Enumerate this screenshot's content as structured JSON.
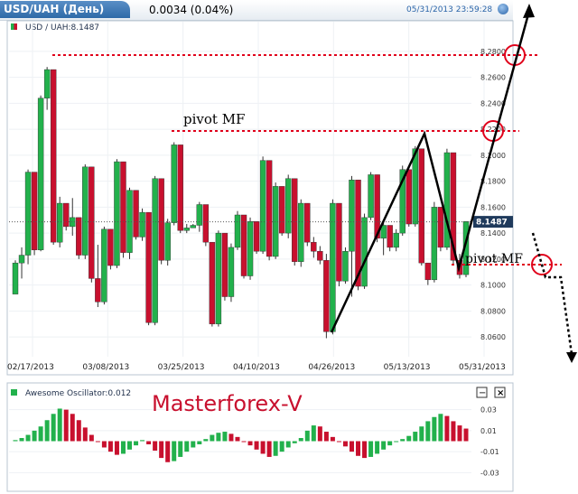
{
  "header": {
    "title": "USD/UAH (День)",
    "change": "0.0034 (0.04%)",
    "timestamp": "05/31/2013 23:59:28"
  },
  "main_panel": {
    "label": "USD / UAH:8.1487",
    "last_price": "8.1487"
  },
  "oscillator_panel": {
    "label": "Awesome Oscillator:0.012",
    "minimize": "−",
    "close": "×"
  },
  "watermark": "Masterforex-V",
  "annotations": {
    "pivot_upper": "pivot MF",
    "pivot_lower": "pivot MF"
  },
  "colors": {
    "up": "#22b14c",
    "down": "#c8102e",
    "pivot_line": "#e0001b",
    "watermark": "#c8102e",
    "header_blue": "#2e6aa8"
  },
  "chart_data": [
    {
      "type": "candlestick",
      "title": "USD / UAH:8.1487",
      "x_tick_labels": [
        "02/17/2013",
        "03/08/2013",
        "03/25/2013",
        "04/10/2013",
        "04/26/2013",
        "05/13/2013",
        "05/31/2013"
      ],
      "y_tick_labels": [
        "8.2800",
        "8.2600",
        "8.2400",
        "8.2200",
        "8.2000",
        "8.1800",
        "8.1600",
        "8.1400",
        "8.1200",
        "8.1000",
        "8.0800",
        "8.0600"
      ],
      "ylim": [
        8.051,
        8.289
      ],
      "grid": true,
      "last_value": 8.1487,
      "ohlc": [
        [
          8.093,
          8.119,
          8.093,
          8.117
        ],
        [
          8.117,
          8.129,
          8.105,
          8.123
        ],
        [
          8.123,
          8.189,
          8.116,
          8.187
        ],
        [
          8.187,
          8.187,
          8.123,
          8.127
        ],
        [
          8.127,
          8.246,
          8.126,
          8.244
        ],
        [
          8.244,
          8.268,
          8.235,
          8.266
        ],
        [
          8.266,
          8.266,
          8.131,
          8.133
        ],
        [
          8.133,
          8.168,
          8.129,
          8.163
        ],
        [
          8.163,
          8.163,
          8.142,
          8.145
        ],
        [
          8.145,
          8.167,
          8.138,
          8.152
        ],
        [
          8.152,
          8.152,
          8.12,
          8.123
        ],
        [
          8.123,
          8.193,
          8.12,
          8.191
        ],
        [
          8.191,
          8.191,
          8.102,
          8.105
        ],
        [
          8.105,
          8.131,
          8.083,
          8.087
        ],
        [
          8.087,
          8.145,
          8.085,
          8.143
        ],
        [
          8.143,
          8.143,
          8.112,
          8.115
        ],
        [
          8.115,
          8.197,
          8.113,
          8.195
        ],
        [
          8.195,
          8.195,
          8.121,
          8.125
        ],
        [
          8.125,
          8.175,
          8.12,
          8.173
        ],
        [
          8.173,
          8.173,
          8.135,
          8.137
        ],
        [
          8.137,
          8.159,
          8.134,
          8.156
        ],
        [
          8.156,
          8.156,
          8.069,
          8.071
        ],
        [
          8.071,
          8.184,
          8.069,
          8.182
        ],
        [
          8.182,
          8.182,
          8.116,
          8.119
        ],
        [
          8.119,
          8.151,
          8.115,
          8.148
        ],
        [
          8.148,
          8.21,
          8.146,
          8.208
        ],
        [
          8.208,
          8.208,
          8.14,
          8.142
        ],
        [
          8.142,
          8.147,
          8.14,
          8.144
        ],
        [
          8.144,
          8.147,
          8.144,
          8.146
        ],
        [
          8.146,
          8.164,
          8.141,
          8.162
        ],
        [
          8.162,
          8.162,
          8.13,
          8.133
        ],
        [
          8.133,
          8.133,
          8.068,
          8.07
        ],
        [
          8.07,
          8.142,
          8.068,
          8.14
        ],
        [
          8.14,
          8.14,
          8.088,
          8.091
        ],
        [
          8.091,
          8.132,
          8.087,
          8.129
        ],
        [
          8.129,
          8.157,
          8.127,
          8.154
        ],
        [
          8.154,
          8.154,
          8.105,
          8.107
        ],
        [
          8.107,
          8.152,
          8.104,
          8.149
        ],
        [
          8.149,
          8.149,
          8.124,
          8.126
        ],
        [
          8.126,
          8.199,
          8.124,
          8.196
        ],
        [
          8.196,
          8.196,
          8.119,
          8.122
        ],
        [
          8.122,
          8.179,
          8.12,
          8.176
        ],
        [
          8.176,
          8.176,
          8.138,
          8.14
        ],
        [
          8.14,
          8.185,
          8.136,
          8.182
        ],
        [
          8.182,
          8.182,
          8.115,
          8.118
        ],
        [
          8.118,
          8.166,
          8.114,
          8.163
        ],
        [
          8.163,
          8.163,
          8.13,
          8.133
        ],
        [
          8.133,
          8.137,
          8.121,
          8.126
        ],
        [
          8.126,
          8.13,
          8.116,
          8.119
        ],
        [
          8.119,
          8.124,
          8.059,
          8.064
        ],
        [
          8.064,
          8.166,
          8.062,
          8.163
        ],
        [
          8.163,
          8.163,
          8.099,
          8.103
        ],
        [
          8.103,
          8.129,
          8.101,
          8.126
        ],
        [
          8.126,
          8.184,
          8.091,
          8.181
        ],
        [
          8.181,
          8.181,
          8.096,
          8.099
        ],
        [
          8.099,
          8.155,
          8.097,
          8.152
        ],
        [
          8.152,
          8.187,
          8.15,
          8.185
        ],
        [
          8.185,
          8.185,
          8.133,
          8.136
        ],
        [
          8.136,
          8.149,
          8.123,
          8.146
        ],
        [
          8.146,
          8.146,
          8.126,
          8.129
        ],
        [
          8.129,
          8.143,
          8.126,
          8.14
        ],
        [
          8.14,
          8.192,
          8.138,
          8.189
        ],
        [
          8.189,
          8.189,
          8.145,
          8.147
        ],
        [
          8.147,
          8.207,
          8.145,
          8.205
        ],
        [
          8.205,
          8.205,
          8.115,
          8.117
        ],
        [
          8.117,
          8.117,
          8.1,
          8.104
        ],
        [
          8.104,
          8.164,
          8.102,
          8.16
        ],
        [
          8.16,
          8.16,
          8.126,
          8.129
        ],
        [
          8.129,
          8.205,
          8.127,
          8.202
        ],
        [
          8.202,
          8.202,
          8.116,
          8.119
        ],
        [
          8.119,
          8.124,
          8.105,
          8.108
        ],
        [
          8.108,
          8.149,
          8.106,
          8.149
        ]
      ]
    },
    {
      "type": "bar",
      "title": "Awesome Oscillator:0.012",
      "y_tick_labels": [
        "0.03",
        "0.01",
        "-0.01",
        "-0.03"
      ],
      "ylim": [
        -0.04,
        0.04
      ],
      "last_value": 0.012,
      "values": [
        0.001,
        0.003,
        0.006,
        0.01,
        0.014,
        0.02,
        0.026,
        0.031,
        0.03,
        0.026,
        0.02,
        0.013,
        0.006,
        0.0,
        -0.006,
        -0.01,
        -0.013,
        -0.012,
        -0.008,
        -0.004,
        0.001,
        -0.003,
        -0.009,
        -0.016,
        -0.02,
        -0.019,
        -0.015,
        -0.01,
        -0.006,
        -0.003,
        0.002,
        0.006,
        0.008,
        0.009,
        0.007,
        0.004,
        0.0,
        -0.004,
        -0.008,
        -0.012,
        -0.015,
        -0.014,
        -0.01,
        -0.006,
        -0.002,
        0.003,
        0.01,
        0.015,
        0.014,
        0.009,
        0.004,
        0.0,
        -0.005,
        -0.01,
        -0.014,
        -0.016,
        -0.015,
        -0.012,
        -0.008,
        -0.004,
        0.0,
        0.002,
        0.005,
        0.009,
        0.014,
        0.019,
        0.023,
        0.026,
        0.024,
        0.019,
        0.015,
        0.012
      ]
    }
  ]
}
